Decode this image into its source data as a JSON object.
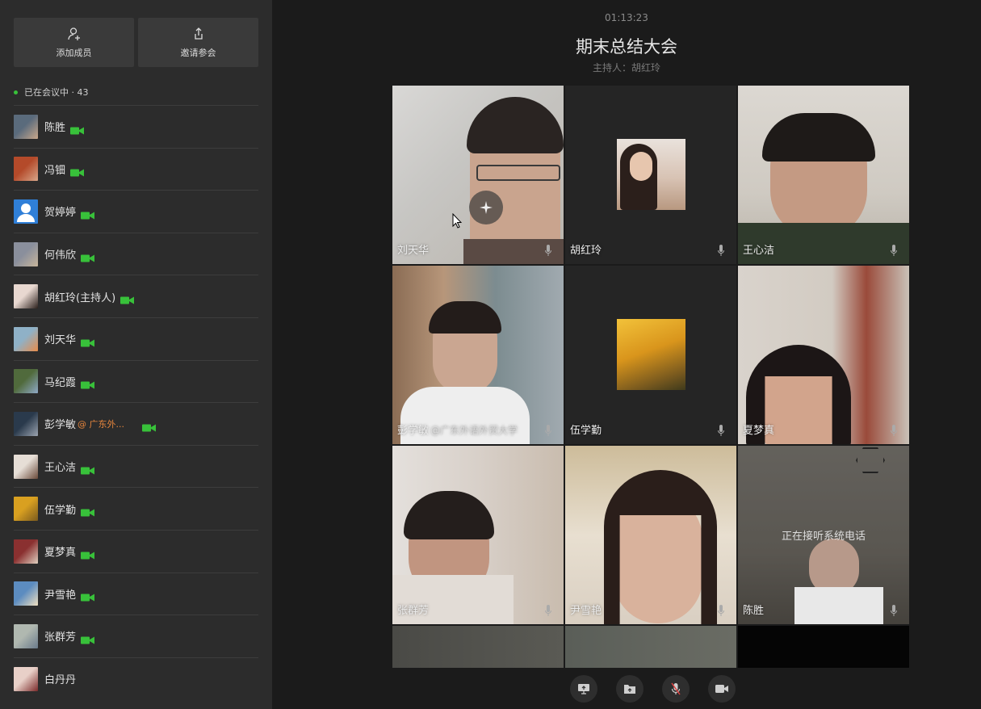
{
  "sidebar": {
    "add_label": "添加成员",
    "invite_label": "邀请参会",
    "count_text": "已在会议中 · 43",
    "participants": [
      {
        "name": "陈胜",
        "camera": true
      },
      {
        "name": "冯钿",
        "camera": true
      },
      {
        "name": "贺婷婷",
        "camera": true
      },
      {
        "name": "何伟欣",
        "camera": true
      },
      {
        "name": "胡红玲(主持人)",
        "camera": true
      },
      {
        "name": "刘天华",
        "camera": true
      },
      {
        "name": "马纪霞",
        "camera": true
      },
      {
        "name": "彭学敏",
        "org": "@ 广东外...",
        "camera": true
      },
      {
        "name": "王心洁",
        "camera": true
      },
      {
        "name": "伍学勤",
        "camera": true
      },
      {
        "name": "夏梦真",
        "camera": true
      },
      {
        "name": "尹雪艳",
        "camera": true
      },
      {
        "name": "张群芳",
        "camera": true
      },
      {
        "name": "白丹丹",
        "camera": false
      }
    ]
  },
  "meeting": {
    "timer": "01:13:23",
    "title": "期末总结大会",
    "host": "主持人：胡红玲"
  },
  "tiles": [
    {
      "name": "刘天华"
    },
    {
      "name": "胡红玲"
    },
    {
      "name": "王心洁"
    },
    {
      "name": "彭学敏",
      "org": "@广东外语外贸大学"
    },
    {
      "name": "伍学勤"
    },
    {
      "name": "夏梦真"
    },
    {
      "name": "张群芳"
    },
    {
      "name": "尹雪艳"
    },
    {
      "name": "陈胜",
      "status": "正在接听系统电话"
    }
  ],
  "colors": {
    "accent_green": "#38c13a",
    "org_orange": "#e8863c"
  },
  "icons": {
    "add_member": "add-user-icon",
    "invite": "share-icon",
    "camera": "video-camera-icon",
    "mic": "microphone-icon"
  }
}
